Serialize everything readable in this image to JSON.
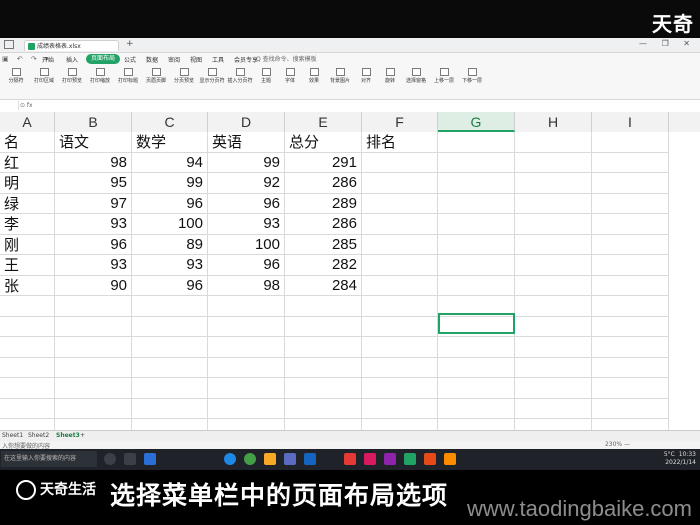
{
  "watermark_top": "天奇",
  "window": {
    "doc_tab": "成绩表格表.xlsx",
    "new_tab": "+",
    "controls": "— ❐ ✕"
  },
  "menu": {
    "quick_access": "▣ ↶ ↷ ▾",
    "items": [
      "开始",
      "插入",
      "页面布局",
      "公式",
      "数据",
      "审阅",
      "视图",
      "工具",
      "会员专享"
    ],
    "search": "Q 查找命令、搜索模板"
  },
  "ribbon": {
    "groups": [
      "分隔符",
      "打印区域",
      "打印预览",
      "打印缩放",
      "打印标题",
      "页眉页脚",
      "分页预览",
      "显示分页符",
      "插入分页符",
      "主题",
      "字体",
      "效果",
      "背景图片",
      "对齐",
      "旋转",
      "选择窗格",
      "上移一层",
      "下移一层"
    ]
  },
  "formula_bar": {
    "fx": "⊙  fx"
  },
  "columns": [
    "A",
    "B",
    "C",
    "D",
    "E",
    "F",
    "G",
    "H",
    "I"
  ],
  "selected_column": "G",
  "table": {
    "headers": [
      "名",
      "语文",
      "数学",
      "英语",
      "总分",
      "排名"
    ],
    "rows": [
      [
        "红",
        "98",
        "94",
        "99",
        "291"
      ],
      [
        "明",
        "95",
        "99",
        "92",
        "286"
      ],
      [
        "绿",
        "97",
        "96",
        "96",
        "289"
      ],
      [
        "李",
        "93",
        "100",
        "93",
        "286"
      ],
      [
        "刚",
        "96",
        "89",
        "100",
        "285"
      ],
      [
        "王",
        "93",
        "93",
        "96",
        "282"
      ],
      [
        "张",
        "90",
        "96",
        "98",
        "284"
      ]
    ]
  },
  "sheets": [
    "Sheet1",
    "Sheet2",
    "Sheet3"
  ],
  "active_sheet": "Sheet3",
  "status": {
    "left": "入你想要做的内容",
    "zoom": "230% —"
  },
  "taskbar": {
    "search_placeholder": "在这里输入你要搜索的内容",
    "weather": "5°C",
    "time": "10:33",
    "date": "2022/1/14"
  },
  "caption": {
    "text": "选择菜单栏中的页面布局选项",
    "brand": "天奇生活",
    "url": "www.taodingbaike.com"
  }
}
